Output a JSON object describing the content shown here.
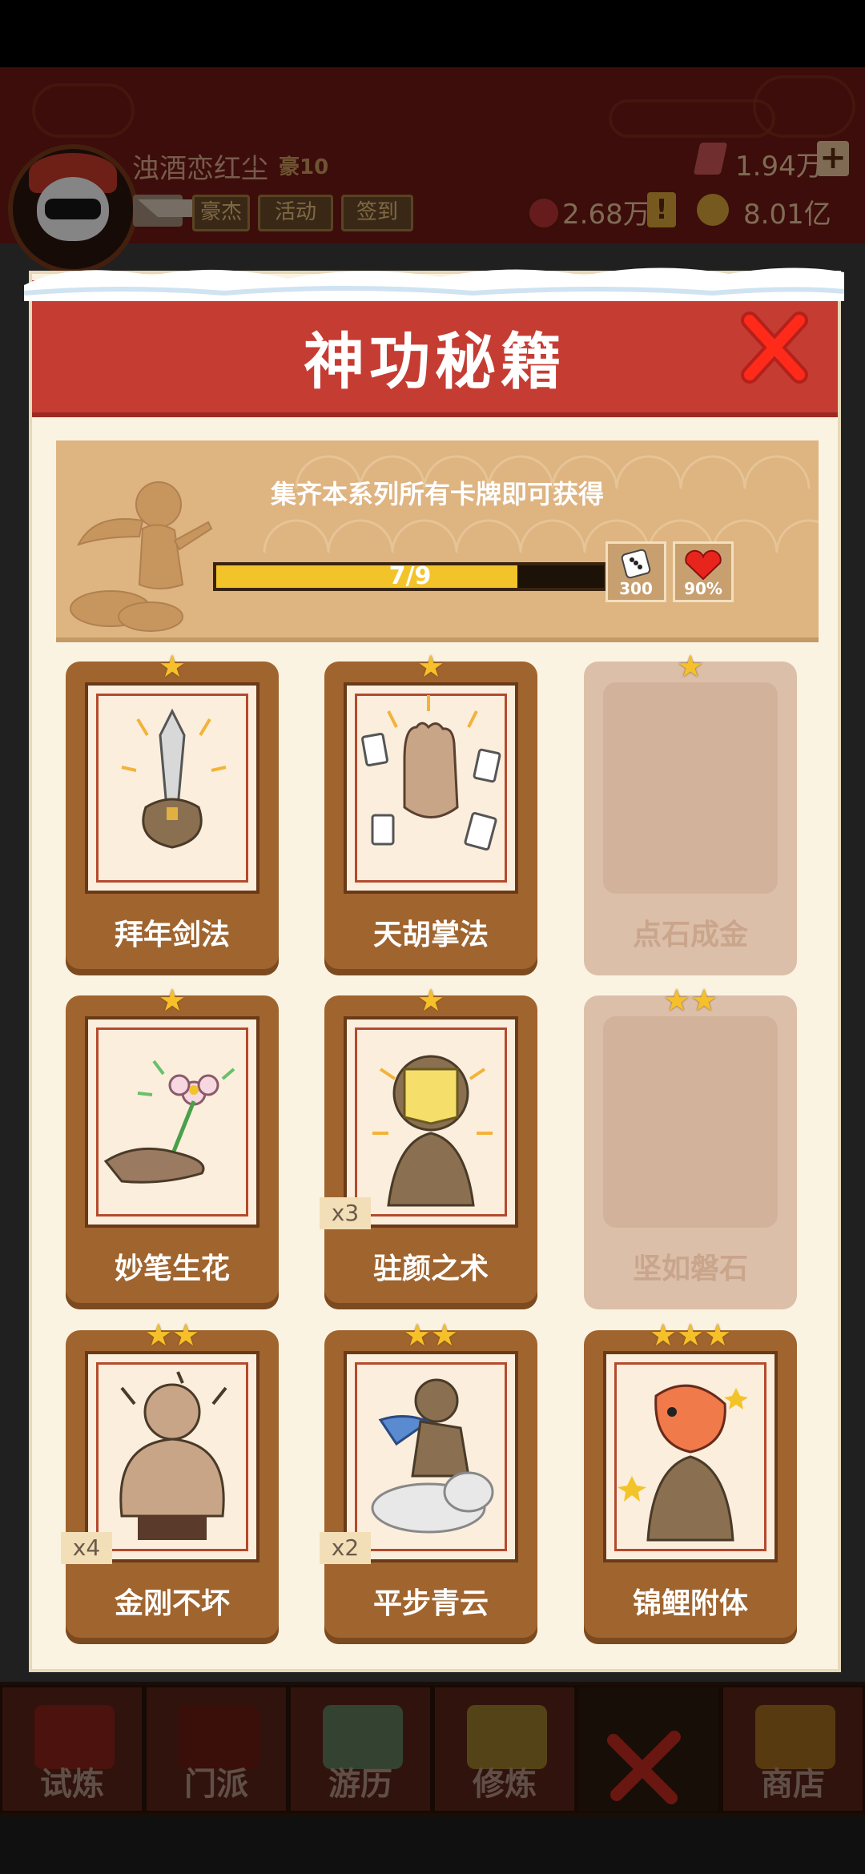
{
  "header": {
    "player_name": "浊酒恋红尘",
    "rank": "豪10",
    "buttons": {
      "hero": "豪杰",
      "activity": "活动",
      "sign_in": "签到"
    },
    "gems": "1.94万",
    "coins": "2.68万",
    "gold": "8.01亿"
  },
  "modal": {
    "title": "神功秘籍",
    "banner_text": "集齐本系列所有卡牌即可获得",
    "progress": {
      "text": "7/9",
      "value": 7,
      "max": 9
    },
    "rewards": [
      {
        "icon": "dice-icon",
        "value": "300"
      },
      {
        "icon": "heart-icon",
        "value": "90%"
      }
    ],
    "cards": [
      {
        "name": "拜年剑法",
        "stars": "★",
        "multiplier": "",
        "locked": false
      },
      {
        "name": "天胡掌法",
        "stars": "★",
        "multiplier": "",
        "locked": false
      },
      {
        "name": "点石成金",
        "stars": "★",
        "multiplier": "",
        "locked": true
      },
      {
        "name": "妙笔生花",
        "stars": "★",
        "multiplier": "",
        "locked": false
      },
      {
        "name": "驻颜之术",
        "stars": "★",
        "multiplier": "x3",
        "locked": false
      },
      {
        "name": "坚如磐石",
        "stars": "★★",
        "multiplier": "",
        "locked": true
      },
      {
        "name": "金刚不坏",
        "stars": "★★",
        "multiplier": "x4",
        "locked": false
      },
      {
        "name": "平步青云",
        "stars": "★★",
        "multiplier": "x2",
        "locked": false
      },
      {
        "name": "锦鲤附体",
        "stars": "★★★",
        "multiplier": "",
        "locked": false
      }
    ]
  },
  "bottom_nav": [
    {
      "label": "试炼"
    },
    {
      "label": "门派"
    },
    {
      "label": "游历"
    },
    {
      "label": "修炼"
    },
    {
      "label": ""
    },
    {
      "label": "商店"
    }
  ],
  "colors": {
    "modal_header": "#c53c33",
    "card_brown": "#a0642e",
    "star": "#f5c02a",
    "progress_fill": "#f2c42a"
  }
}
